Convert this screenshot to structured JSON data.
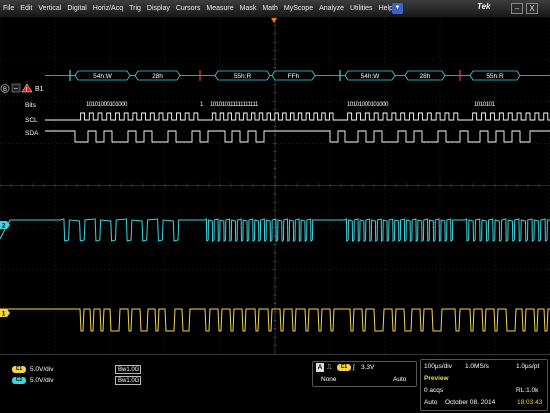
{
  "menu": {
    "items": [
      "File",
      "Edit",
      "Vertical",
      "Digital",
      "Horiz/Acq",
      "Trig",
      "Display",
      "Cursors",
      "Measure",
      "Mask",
      "Math",
      "MyScope",
      "Analyze",
      "Utilities",
      "Help"
    ],
    "brand": "Tek",
    "dropdown_icon": "chevron-down-icon"
  },
  "window": {
    "minimize": "–",
    "close": "X"
  },
  "bus": {
    "label": "B1",
    "warning_icon": "warning-icon",
    "values": [
      "54h:W",
      "28h",
      "55h:R",
      "FFh",
      "54h:W",
      "28h",
      "55h:R"
    ]
  },
  "rows": {
    "bits_label": "Bits",
    "scl_label": "SCL",
    "sda_label": "SDA",
    "bits": [
      "1 0 1 0 1 0 0 0 1 0 1 0 0 0",
      "1",
      "1 0 1 0 1 0 1 1 1 1 1 1 1 1 1 1 1 1",
      "1 0 1 0 1 0 0 0 1 0 1 0 0 0",
      "1 0 1 0 1 0 1"
    ]
  },
  "markers": {
    "bus_marker": "B",
    "ch1_marker": "1",
    "ch2_marker": "2"
  },
  "channels": [
    {
      "badge": "C1",
      "scale": "5.0V/div",
      "bw": "Bw1.0G",
      "color": "#f4d54a"
    },
    {
      "badge": "C2",
      "scale": "5.0V/div",
      "bw": "Bw1.0G",
      "color": "#3bd5e0"
    }
  ],
  "trigger": {
    "badge": "C1",
    "level": "3.3V",
    "source": "None",
    "mode": "Auto",
    "a_label": "A"
  },
  "acquisition": {
    "timebase": "100µs/div",
    "rate": "1.0MS/s",
    "resolution": "1.0µs/pt",
    "state": "Preview",
    "acqs": "0 acqs",
    "record_length": "RL:1.0k",
    "mode": "Auto",
    "date": "October 08, 2014",
    "time": "18:03:43"
  },
  "colors": {
    "ch1": "#f4d54a",
    "ch2": "#3bd5e0",
    "bus": "#b05ac8",
    "grid": "#3a3a3a"
  }
}
